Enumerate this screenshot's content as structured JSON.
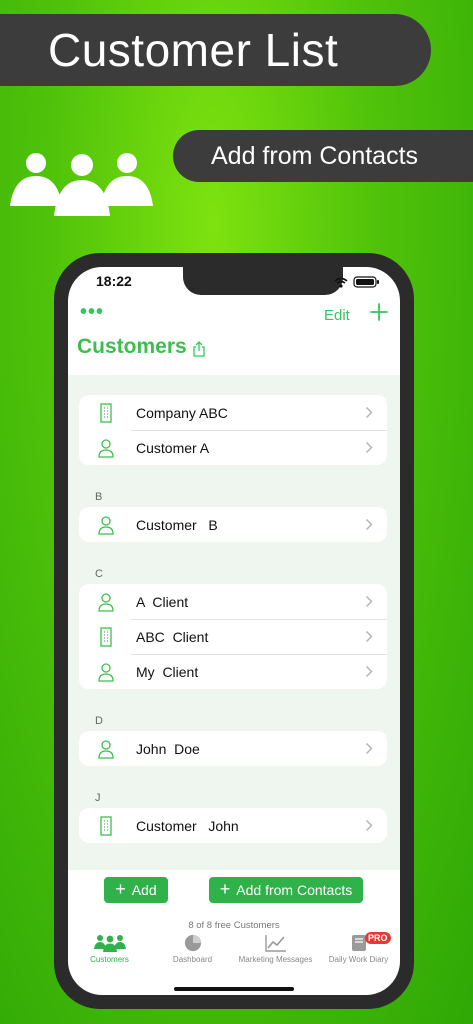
{
  "banner": {
    "title": "Customer List",
    "subtitle": "Add from Contacts"
  },
  "status": {
    "time": "18:22"
  },
  "nav": {
    "more": "•••",
    "edit": "Edit"
  },
  "page": {
    "title": "Customers"
  },
  "sections": [
    {
      "letter": "",
      "items": [
        {
          "icon": "building-icon",
          "label": "Company ABC"
        },
        {
          "icon": "person-icon",
          "label": "Customer A"
        }
      ]
    },
    {
      "letter": "B",
      "items": [
        {
          "icon": "person-icon",
          "label": "Customer   B"
        }
      ]
    },
    {
      "letter": "C",
      "items": [
        {
          "icon": "person-icon",
          "label": "A  Client"
        },
        {
          "icon": "building-icon",
          "label": "ABC  Client"
        },
        {
          "icon": "person-icon",
          "label": "My  Client"
        }
      ]
    },
    {
      "letter": "D",
      "items": [
        {
          "icon": "person-icon",
          "label": "John  Doe"
        }
      ]
    },
    {
      "letter": "J",
      "items": [
        {
          "icon": "building-icon",
          "label": "Customer   John"
        }
      ]
    }
  ],
  "actions": {
    "add": "Add",
    "add_contacts": "Add from Contacts"
  },
  "footer": {
    "free_note": "8 of 8 free Customers"
  },
  "tabs": [
    {
      "label": "Customers",
      "icon": "people-icon",
      "active": true
    },
    {
      "label": "Dashboard",
      "icon": "pie-chart-icon",
      "active": false
    },
    {
      "label": "Marketing Messages",
      "icon": "line-chart-icon",
      "active": false
    },
    {
      "label": "Daily Work Diary",
      "icon": "book-icon",
      "active": false,
      "badge": "PRO"
    }
  ],
  "colors": {
    "accent": "#34c759",
    "button": "#2fb24a",
    "badge": "#e53935"
  }
}
